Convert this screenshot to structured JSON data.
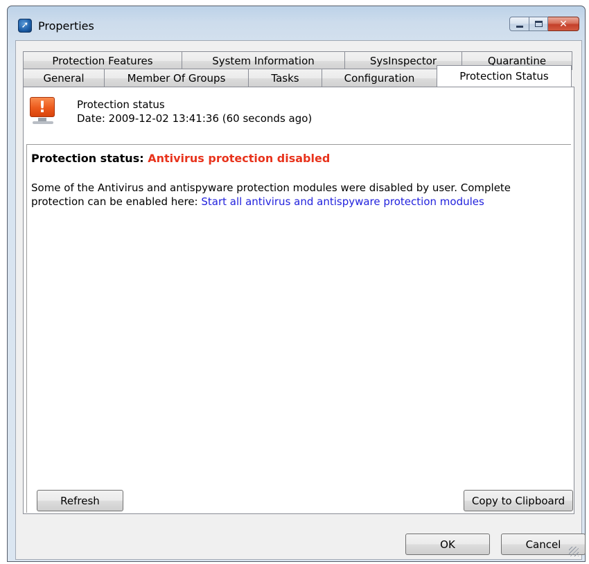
{
  "window": {
    "title": "Properties"
  },
  "tabs": {
    "back_row": [
      "Protection Features",
      "System Information",
      "SysInspector",
      "Quarantine"
    ],
    "front_row": [
      "General",
      "Member Of Groups",
      "Tasks",
      "Configuration",
      "Protection Status"
    ],
    "active": "Protection Status"
  },
  "status": {
    "title": "Protection status",
    "date": "Date: 2009-12-02 13:41:36 (60 seconds ago)"
  },
  "report": {
    "heading_label": "Protection status:",
    "heading_value": "Antivirus protection disabled",
    "body_text": "Some of the Antivirus and antispyware protection modules were disabled by user. Complete protection can be enabled here: ",
    "link_text": "Start all antivirus and antispyware protection modules"
  },
  "buttons": {
    "refresh": "Refresh",
    "copy": "Copy to Clipboard",
    "ok": "OK",
    "cancel": "Cancel"
  },
  "colors": {
    "alert_red": "#e8331c",
    "link_blue": "#2222dd",
    "warning_orange": "#ec5a1c"
  },
  "icons": [
    "app-icon",
    "minimize-icon",
    "maximize-icon",
    "close-icon",
    "warning-monitor-icon",
    "resize-grip-icon"
  ]
}
